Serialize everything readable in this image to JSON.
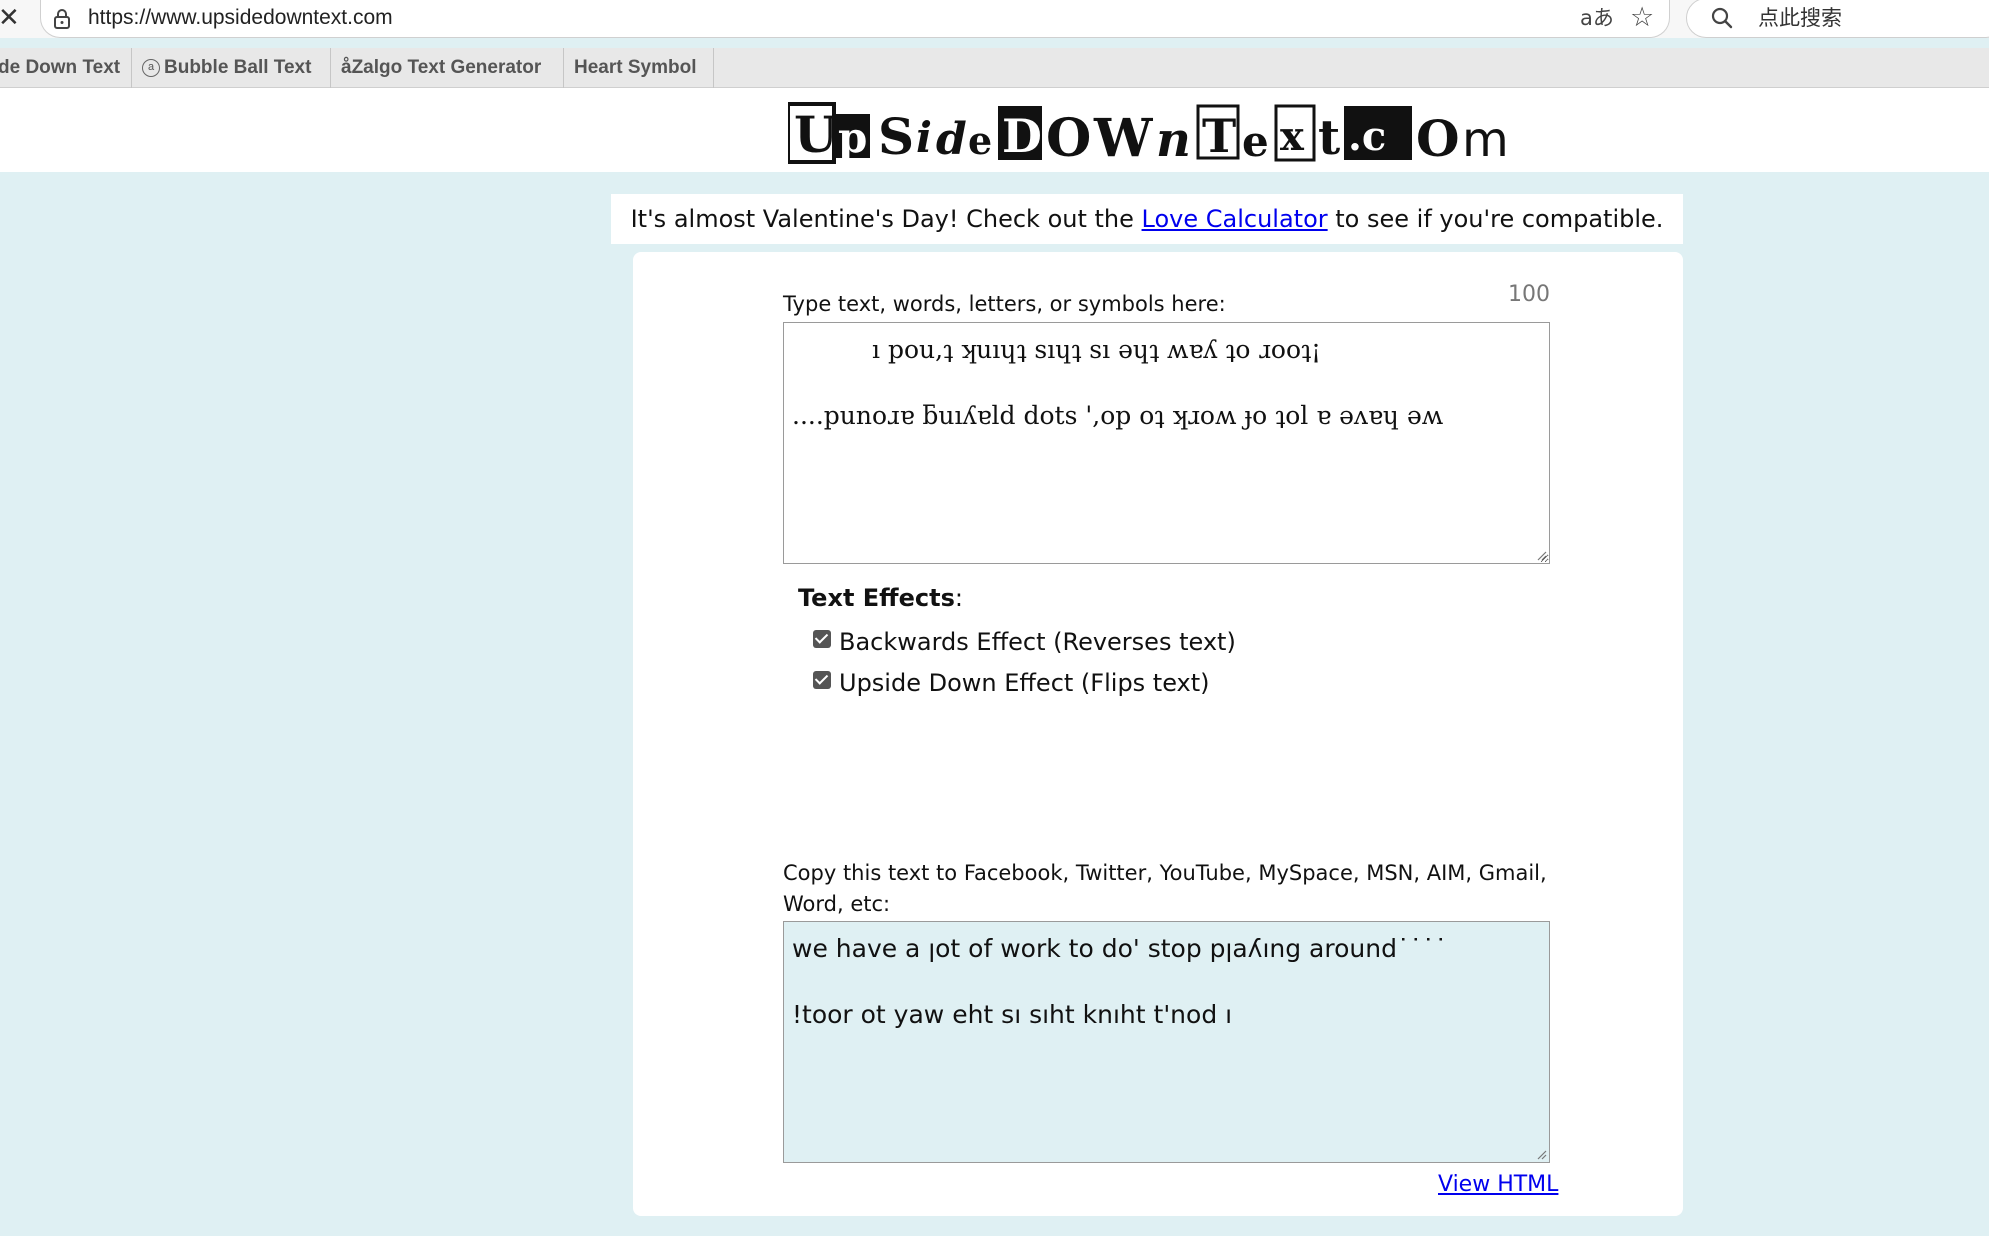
{
  "browser": {
    "url": "https://www.upsidedowntext.com",
    "read_aloud_glyph": "aあ",
    "search_placeholder": "点此搜索"
  },
  "bookmarks": [
    {
      "label": "de Down Text"
    },
    {
      "label": "Bubble Ball Text",
      "icon_glyph": "a"
    },
    {
      "label": "Zalgo Text Generator",
      "icon_glyph": "å"
    },
    {
      "label": "Heart Symbol"
    }
  ],
  "logo": {
    "text": "UpsideDOWnText.com"
  },
  "announcement": {
    "before": "It's almost Valentine's Day! Check out the ",
    "link": "Love Calculator",
    "after": " to see if you're compatible."
  },
  "input": {
    "label": "Type text, words, letters, or symbols here:",
    "counter": "100",
    "line1": "ı pou,ʇ ʞuıɥʇ sıɥʇ sı ǝɥʇ ʍɐʎ ʇo ɹooʇ¡",
    "line2": "....punoɹɐ ƃuıʎɐld dots ',op oʇ ʞɹoʍ ɟo ʇol ɐ ǝʌɐɥ ǝʍ"
  },
  "effects": {
    "title": "Text Effects",
    "title_suffix": ":",
    "backwards": {
      "label": "Backwards Effect (Reverses text)",
      "checked": true
    },
    "upside_down": {
      "label": "Upside Down Effect (Flips text)",
      "checked": true
    }
  },
  "output": {
    "label": "Copy this text to Facebook, Twitter, YouTube, MySpace, MSN, AIM, Gmail, Word, etc:",
    "line1": "we have a ןot of work to do' stop pןaʎıng around˙˙˙˙",
    "line2": "!toor ot yaw eht sı sıht knıht t'nod ı"
  },
  "footer": {
    "view_html": "View HTML"
  },
  "colors": {
    "page_bg": "#dff0f3",
    "link": "#0000ee",
    "output_bg": "#dff0f3"
  }
}
